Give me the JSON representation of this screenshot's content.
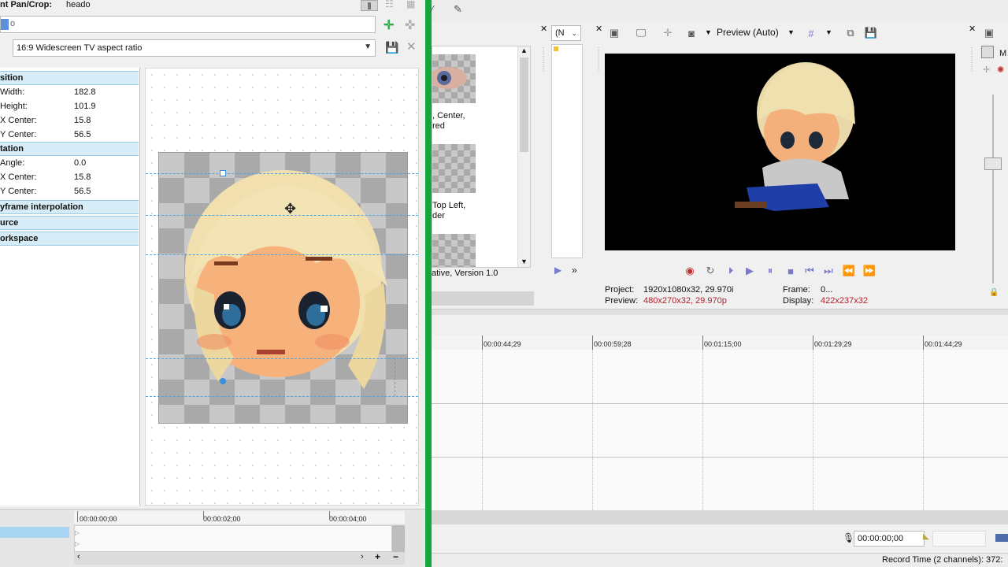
{
  "pan_crop": {
    "title_label": "nt Pan/Crop:",
    "title_value": "heado",
    "position_field": "o",
    "aspect_select": "16:9 Widescreen TV aspect ratio",
    "sections": {
      "position": "sition",
      "rotation": "tation",
      "keyframe": "yframe interpolation",
      "source": "urce",
      "workspace": "orkspace"
    },
    "position_props": [
      {
        "key": "Width:",
        "value": "182.8"
      },
      {
        "key": "Height:",
        "value": "101.9"
      },
      {
        "key": "X Center:",
        "value": "15.8"
      },
      {
        "key": "Y Center:",
        "value": "56.5"
      }
    ],
    "rotation_props": [
      {
        "key": "Angle:",
        "value": "0.0"
      },
      {
        "key": "X Center:",
        "value": "15.8"
      },
      {
        "key": "Y Center:",
        "value": "56.5"
      }
    ],
    "timeline": {
      "labels": [
        "00:00:00;00",
        "00:00:02;00",
        "00:00:04;00"
      ]
    }
  },
  "media": {
    "items": [
      {
        "label": ", Center,\nred"
      },
      {
        "label": "Top Left,\nder"
      },
      {
        "label": ""
      }
    ],
    "footer": "ative, Version 1.0"
  },
  "preview": {
    "filter_select": "(N",
    "quality_label": "Preview (Auto)",
    "project_label": "Project:",
    "project_value": "1920x1080x32, 29.970i",
    "preview_label": "Preview:",
    "preview_value": "480x270x32, 29.970p",
    "frame_label": "Frame:",
    "frame_value": "0...",
    "display_label": "Display:",
    "display_value": "422x237x32",
    "side_label": "M"
  },
  "timeline": {
    "labels": [
      "00:00:44;29",
      "00:00:59;28",
      "00:01:15;00",
      "00:01:29;29",
      "00:01:44;29"
    ],
    "time_display": "00:00:00;00",
    "record_time": "Record Time (2 channels): 372:"
  },
  "colors": {
    "divider": "#12a83c",
    "header_bg": "#d6ecf7",
    "info_red": "#b0202a"
  }
}
